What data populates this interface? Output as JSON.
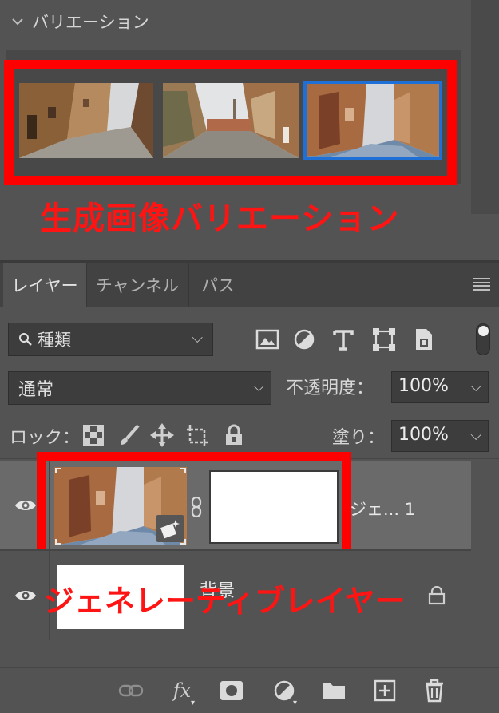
{
  "variations": {
    "title": "バリエーション",
    "collapse_icon": "chevron-down-icon",
    "selected_index": 3,
    "selection_color": "#1e6fd6",
    "annotation": "生成画像バリエーション"
  },
  "layers_panel": {
    "tabs": [
      {
        "label": "レイヤー",
        "active": true
      },
      {
        "label": "チャンネル",
        "active": false
      },
      {
        "label": "パス",
        "active": false
      }
    ],
    "filter": {
      "label": "種類",
      "icon": "search-icon"
    },
    "filter_icons": [
      "image-filter-icon",
      "adjustment-filter-icon",
      "type-filter-icon",
      "shape-filter-icon",
      "smart-object-filter-icon"
    ],
    "blend_mode": "通常",
    "opacity_label": "不透明度：",
    "opacity_value": "100%",
    "lock_label": "ロック：",
    "lock_icons": [
      "lock-transparent-pixels-icon",
      "lock-image-pixels-icon",
      "lock-position-icon",
      "lock-artboard-icon",
      "lock-all-icon"
    ],
    "fill_label": "塗り：",
    "fill_value": "100%",
    "layers": [
      {
        "name": "ジェ... 1",
        "type": "generative",
        "selected": true
      },
      {
        "name": "背景",
        "type": "background",
        "locked": true
      }
    ],
    "annotation": "ジェネレーティブレイヤー",
    "footer_icons": [
      "link-layers-icon",
      "fx-icon",
      "add-mask-icon",
      "adjustment-layer-icon",
      "group-folder-icon",
      "new-layer-icon",
      "trash-icon"
    ],
    "footer_fx": "fx"
  },
  "colors": {
    "panel_bg": "#535353",
    "annotation_red": "#ff0000",
    "selected_row": "#6a6a6a"
  }
}
